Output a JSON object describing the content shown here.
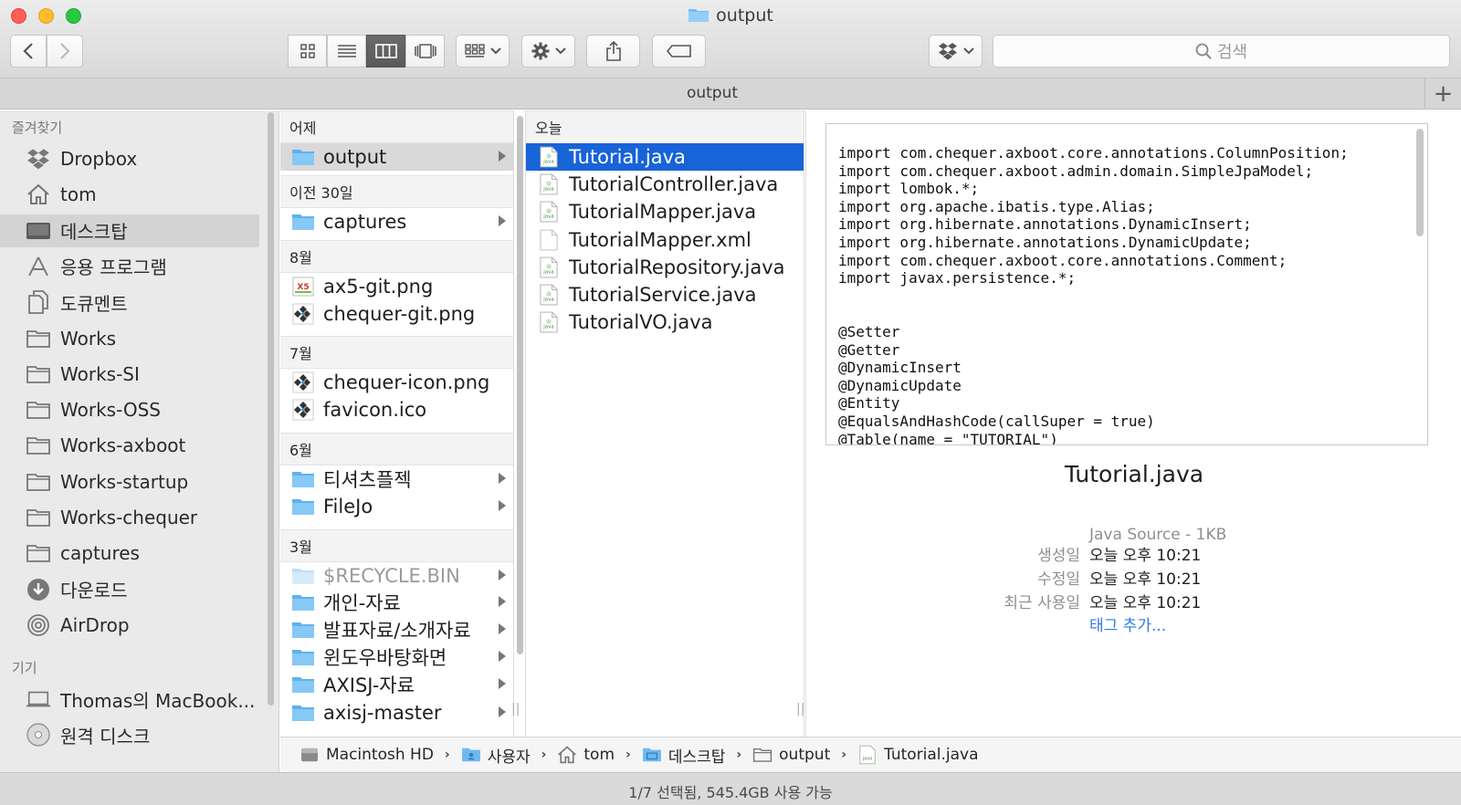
{
  "window": {
    "title": "output"
  },
  "toolbar": {
    "search_placeholder": "검색",
    "accent": "#1763d8"
  },
  "tab": {
    "label": "output",
    "add_label": "+"
  },
  "sidebar": {
    "favorites_heading": "즐겨찾기",
    "devices_heading": "기기",
    "favorites": [
      {
        "label": "Dropbox",
        "icon": "dropbox-icon"
      },
      {
        "label": "tom",
        "icon": "home-icon"
      },
      {
        "label": "데스크탑",
        "icon": "desktop-icon",
        "selected": true
      },
      {
        "label": "응용 프로그램",
        "icon": "applications-icon"
      },
      {
        "label": "도큐멘트",
        "icon": "documents-icon"
      },
      {
        "label": "Works",
        "icon": "folder-icon"
      },
      {
        "label": "Works-SI",
        "icon": "folder-icon"
      },
      {
        "label": "Works-OSS",
        "icon": "folder-icon"
      },
      {
        "label": "Works-axboot",
        "icon": "folder-icon"
      },
      {
        "label": "Works-startup",
        "icon": "folder-icon"
      },
      {
        "label": "Works-chequer",
        "icon": "folder-icon"
      },
      {
        "label": "captures",
        "icon": "folder-icon"
      },
      {
        "label": "다운로드",
        "icon": "download-icon"
      },
      {
        "label": "AirDrop",
        "icon": "airdrop-icon"
      }
    ],
    "devices": [
      {
        "label": "Thomas의 MacBook...",
        "icon": "laptop-icon"
      },
      {
        "label": "원격 디스크",
        "icon": "disc-icon"
      }
    ]
  },
  "column1": {
    "groups": [
      {
        "heading": "어제",
        "items": [
          {
            "label": "output",
            "type": "folder",
            "state": "inactive-selected",
            "arrow": true
          }
        ]
      },
      {
        "heading": "이전 30일",
        "items": [
          {
            "label": "captures",
            "type": "folder",
            "arrow": true
          }
        ]
      },
      {
        "heading": "8월",
        "items": [
          {
            "label": "ax5-git.png",
            "type": "image-ax5"
          },
          {
            "label": "chequer-git.png",
            "type": "image-chequer"
          }
        ]
      },
      {
        "heading": "7월",
        "items": [
          {
            "label": "chequer-icon.png",
            "type": "image-chequer"
          },
          {
            "label": "favicon.ico",
            "type": "image-chequer"
          }
        ]
      },
      {
        "heading": "6월",
        "items": [
          {
            "label": "티셔츠플젝",
            "type": "folder",
            "arrow": true
          },
          {
            "label": "FileJo",
            "type": "folder",
            "arrow": true
          }
        ]
      },
      {
        "heading": "3월",
        "items": [
          {
            "label": "$RECYCLE.BIN",
            "type": "folder-dim",
            "arrow": true,
            "dim": true
          },
          {
            "label": "개인-자료",
            "type": "folder",
            "arrow": true
          },
          {
            "label": "발표자료/소개자료",
            "type": "folder",
            "arrow": true
          },
          {
            "label": "윈도우바탕화면",
            "type": "folder",
            "arrow": true
          },
          {
            "label": "AXISJ-자료",
            "type": "folder",
            "arrow": true
          },
          {
            "label": "axisj-master",
            "type": "folder",
            "arrow": true
          }
        ]
      }
    ]
  },
  "column2": {
    "heading": "오늘",
    "items": [
      {
        "label": "Tutorial.java",
        "type": "java",
        "state": "active"
      },
      {
        "label": "TutorialController.java",
        "type": "java"
      },
      {
        "label": "TutorialMapper.java",
        "type": "java"
      },
      {
        "label": "TutorialMapper.xml",
        "type": "blank"
      },
      {
        "label": "TutorialRepository.java",
        "type": "java"
      },
      {
        "label": "TutorialService.java",
        "type": "java"
      },
      {
        "label": "TutorialVO.java",
        "type": "java"
      }
    ]
  },
  "preview": {
    "code_lines": [
      "import com.chequer.axboot.core.annotations.ColumnPosition;",
      "import com.chequer.axboot.admin.domain.SimpleJpaModel;",
      "import lombok.*;",
      "import org.apache.ibatis.type.Alias;",
      "import org.hibernate.annotations.DynamicInsert;",
      "import org.hibernate.annotations.DynamicUpdate;",
      "import com.chequer.axboot.core.annotations.Comment;",
      "import javax.persistence.*;",
      "",
      "",
      "@Setter",
      "@Getter",
      "@DynamicInsert",
      "@DynamicUpdate",
      "@Entity",
      "@EqualsAndHashCode(callSuper = true)",
      "@Table(name = \"TUTORIAL\")"
    ],
    "file_name": "Tutorial.java",
    "kind": "Java Source - 1KB",
    "meta": [
      {
        "key": "생성일",
        "value": "오늘 오후 10:21"
      },
      {
        "key": "수정일",
        "value": "오늘 오후 10:21"
      },
      {
        "key": "최근 사용일",
        "value": "오늘 오후 10:21"
      }
    ],
    "tag_link": "태그 추가..."
  },
  "pathbar": [
    {
      "label": "Macintosh HD",
      "icon": "hard-drive-icon"
    },
    {
      "label": "사용자",
      "icon": "users-folder-icon"
    },
    {
      "label": "tom",
      "icon": "home-icon"
    },
    {
      "label": "데스크탑",
      "icon": "desktop-folder-icon"
    },
    {
      "label": "output",
      "icon": "folder-icon"
    },
    {
      "label": "Tutorial.java",
      "icon": "java-file-icon"
    }
  ],
  "status": {
    "text": "1/7 선택됨, 545.4GB 사용 가능"
  }
}
